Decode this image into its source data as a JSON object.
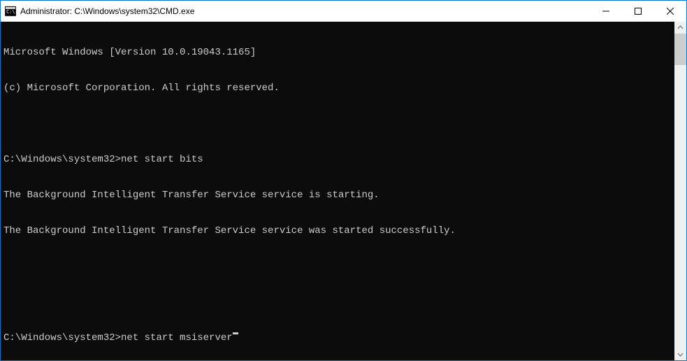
{
  "window": {
    "title": "Administrator: C:\\Windows\\system32\\CMD.exe"
  },
  "console": {
    "lines": [
      "Microsoft Windows [Version 10.0.19043.1165]",
      "(c) Microsoft Corporation. All rights reserved.",
      "",
      "",
      "The Background Intelligent Transfer Service service is starting.",
      "The Background Intelligent Transfer Service service was started successfully.",
      "",
      ""
    ],
    "prompt1_path": "C:\\Windows\\system32>",
    "prompt1_cmd": "net start bits",
    "prompt2_path": "C:\\Windows\\system32>",
    "prompt2_cmd": "net start msiserver"
  }
}
